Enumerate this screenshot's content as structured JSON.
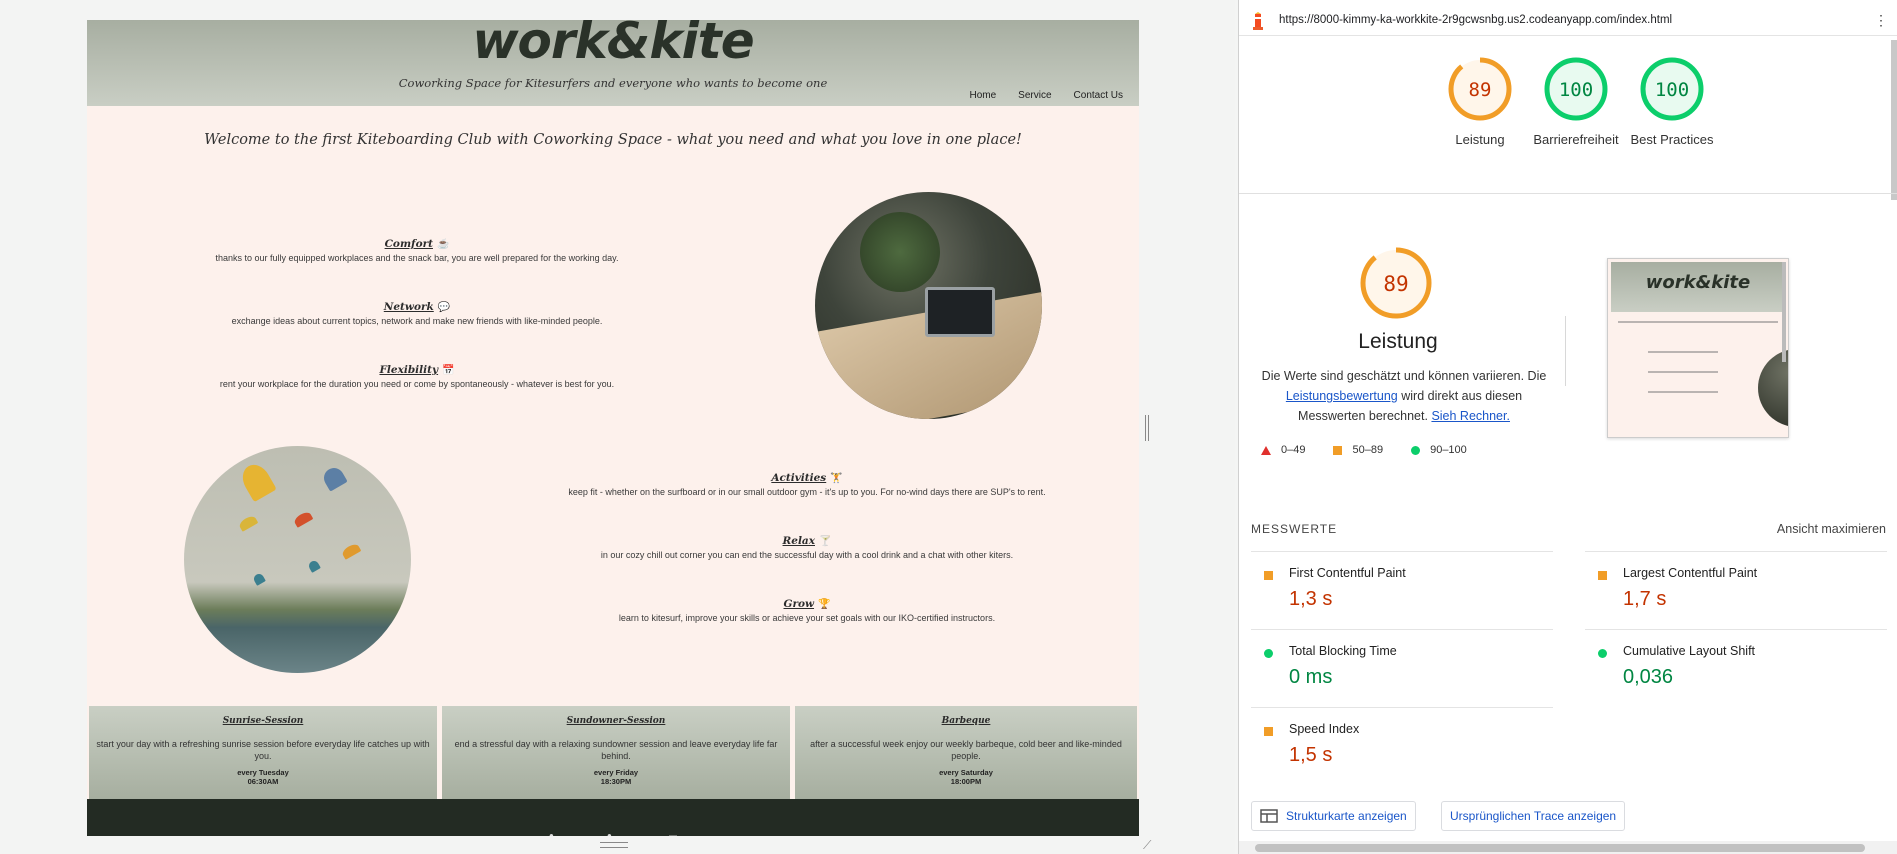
{
  "site": {
    "logo": "work&kite",
    "tagline": "Coworking Space for Kitesurfers and everyone who wants to become one",
    "nav": [
      "Home",
      "Service",
      "Contact Us"
    ],
    "welcome": "Welcome to the first Kiteboarding Club with Coworking Space - what you need and what you love in one place!",
    "features_top": [
      {
        "title": "Comfort",
        "icon": "coffee-icon",
        "glyph": "☕",
        "desc": "thanks to our fully equipped workplaces and the snack bar, you are well prepared for the working day."
      },
      {
        "title": "Network",
        "icon": "comments-icon",
        "glyph": "💬",
        "desc": "exchange ideas about current topics, network and make new friends with like-minded people."
      },
      {
        "title": "Flexibility",
        "icon": "calendar-icon",
        "glyph": "📅",
        "desc": "rent your workplace for the duration you need or come by spontaneously - whatever is best for you."
      }
    ],
    "features_bottom": [
      {
        "title": "Activities",
        "icon": "dumbbell-icon",
        "glyph": "🏋",
        "desc": "keep fit - whether on the surfboard or in our small outdoor gym - it's up to you. For no-wind days there are SUP's to rent."
      },
      {
        "title": "Relax",
        "icon": "cocktail-icon",
        "glyph": "🍸",
        "desc": "in our cozy chill out corner you can end the successful day with a cool drink and a chat with other kiters."
      },
      {
        "title": "Grow",
        "icon": "trophy-icon",
        "glyph": "🏆",
        "desc": "learn to kitesurf, improve your skills or achieve your set goals with our IKO-certified instructors."
      }
    ],
    "sessions": [
      {
        "title": "Sunrise-Session",
        "desc": "start your day with a refreshing sunrise session before everyday life catches up with you.",
        "when": "every Tuesday",
        "time": "06:30AM"
      },
      {
        "title": "Sundowner-Session",
        "desc": "end a stressful day with a relaxing sundowner session and leave everyday life far behind.",
        "when": "every Friday",
        "time": "18:30PM"
      },
      {
        "title": "Barbeque",
        "desc": "after a successful week enjoy our weekly barbeque, cold beer and like-minded people.",
        "when": "every Saturday",
        "time": "18:00PM"
      }
    ]
  },
  "devtools": {
    "url": "https://8000-kimmy-ka-workkite-2r9gcwsnbg.us2.codeanyapp.com/index.html",
    "gauges": [
      {
        "score": "89",
        "label": "Leistung",
        "color": "#f19d27",
        "fill": "#fff6ea",
        "text_color": "#c33300",
        "value": 89
      },
      {
        "score": "100",
        "label": "Barrierefreiheit",
        "color": "#0cce6b",
        "fill": "#e8faf0",
        "text_color": "#018642",
        "value": 100
      },
      {
        "score": "100",
        "label": "Best Practices",
        "color": "#0cce6b",
        "fill": "#e8faf0",
        "text_color": "#018642",
        "value": 100
      }
    ],
    "perf": {
      "score": "89",
      "title": "Leistung",
      "desc_1": "Die Werte sind geschätzt und können variieren. Die ",
      "link_1": "Leistungsbewertung",
      "desc_2": " wird direkt aus diesen Messwerten berechnet. ",
      "link_2": "Sieh Rechner."
    },
    "legend": [
      "0–49",
      "50–89",
      "90–100"
    ],
    "thumb_logo": "work&kite",
    "metrics_heading": "MESSWERTE",
    "expand": "Ansicht maximieren",
    "metrics": [
      {
        "name": "First Contentful Paint",
        "value": "1,3 s",
        "status": "orange"
      },
      {
        "name": "Largest Contentful Paint",
        "value": "1,7 s",
        "status": "orange"
      },
      {
        "name": "Total Blocking Time",
        "value": "0 ms",
        "status": "green"
      },
      {
        "name": "Cumulative Layout Shift",
        "value": "0,036",
        "status": "green"
      },
      {
        "name": "Speed Index",
        "value": "1,5 s",
        "status": "orange"
      }
    ],
    "buttons": [
      "Strukturkarte anzeigen",
      "Ursprünglichen Trace anzeigen"
    ]
  }
}
